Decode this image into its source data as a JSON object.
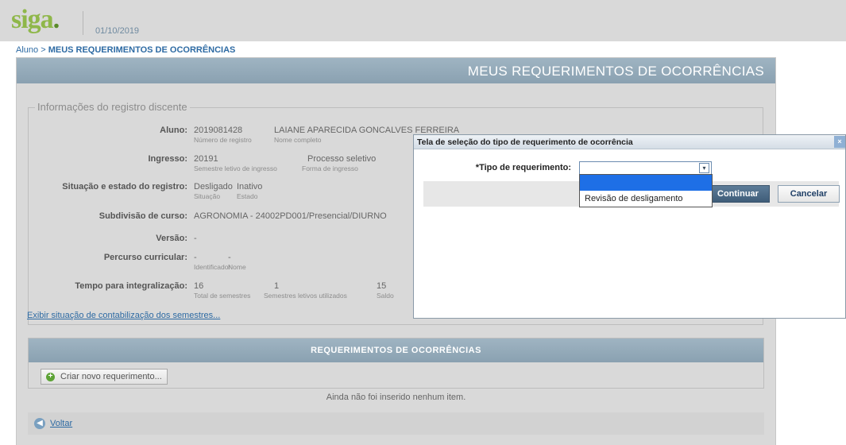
{
  "header": {
    "logo": "siga",
    "logo_dot": ".",
    "date": "01/10/2019"
  },
  "breadcrumb": {
    "root": "Aluno",
    "sep": " > ",
    "current": "MEUS REQUERIMENTOS DE OCORRÊNCIAS"
  },
  "page_title": "MEUS REQUERIMENTOS DE OCORRÊNCIAS",
  "info": {
    "legend": "Informações do registro discente",
    "aluno": {
      "label": "Aluno:",
      "numero": "2019081428",
      "numero_sub": "Número de registro",
      "nome": "LAIANE APARECIDA GONCALVES FERREIRA",
      "nome_sub": "Nome completo"
    },
    "ingresso": {
      "label": "Ingresso:",
      "semestre": "20191",
      "semestre_sub": "Semestre letivo de ingresso",
      "forma": "Processo seletivo",
      "forma_sub": "Forma de ingresso"
    },
    "situacao": {
      "label": "Situação e estado do registro:",
      "situacao": "Desligado",
      "situacao_sub": "Situação",
      "estado": "Inativo",
      "estado_sub": "Estado"
    },
    "subdivisao": {
      "label": "Subdivisão de curso:",
      "value": "AGRONOMIA - 24002PD001/Presencial/DIURNO"
    },
    "versao": {
      "label": "Versão:",
      "value": "-"
    },
    "percurso": {
      "label": "Percurso curricular:",
      "id": "-",
      "id_sub": "Identificador",
      "nome": "-",
      "nome_sub": "Nome"
    },
    "tempo": {
      "label": "Tempo para integralização:",
      "total": "16",
      "total_sub": "Total de semestres",
      "usados": "1",
      "usados_sub": "Semestres letivos utilizados",
      "saldo": "15",
      "saldo_sub": "Saldo"
    },
    "link": "Exibir situação de contabilização dos semestres..."
  },
  "requerimentos": {
    "title": "REQUERIMENTOS DE OCORRÊNCIAS",
    "new_button": "Criar novo requerimento...",
    "empty": "Ainda não foi inserido nenhum item."
  },
  "back": "Voltar",
  "modal": {
    "title": "Tela de seleção do tipo de requerimento de ocorrência",
    "close": "×",
    "field_label": "*Tipo de requerimento:",
    "selected": "",
    "options": [
      "",
      "Revisão de desligamento"
    ],
    "continue": "Continuar",
    "cancel": "Cancelar"
  },
  "colors": {
    "header_blue": "#8aa1b1",
    "link": "#2d6aa3",
    "logo_green": "#8fb74a",
    "selected_option": "#1e6fe6"
  }
}
